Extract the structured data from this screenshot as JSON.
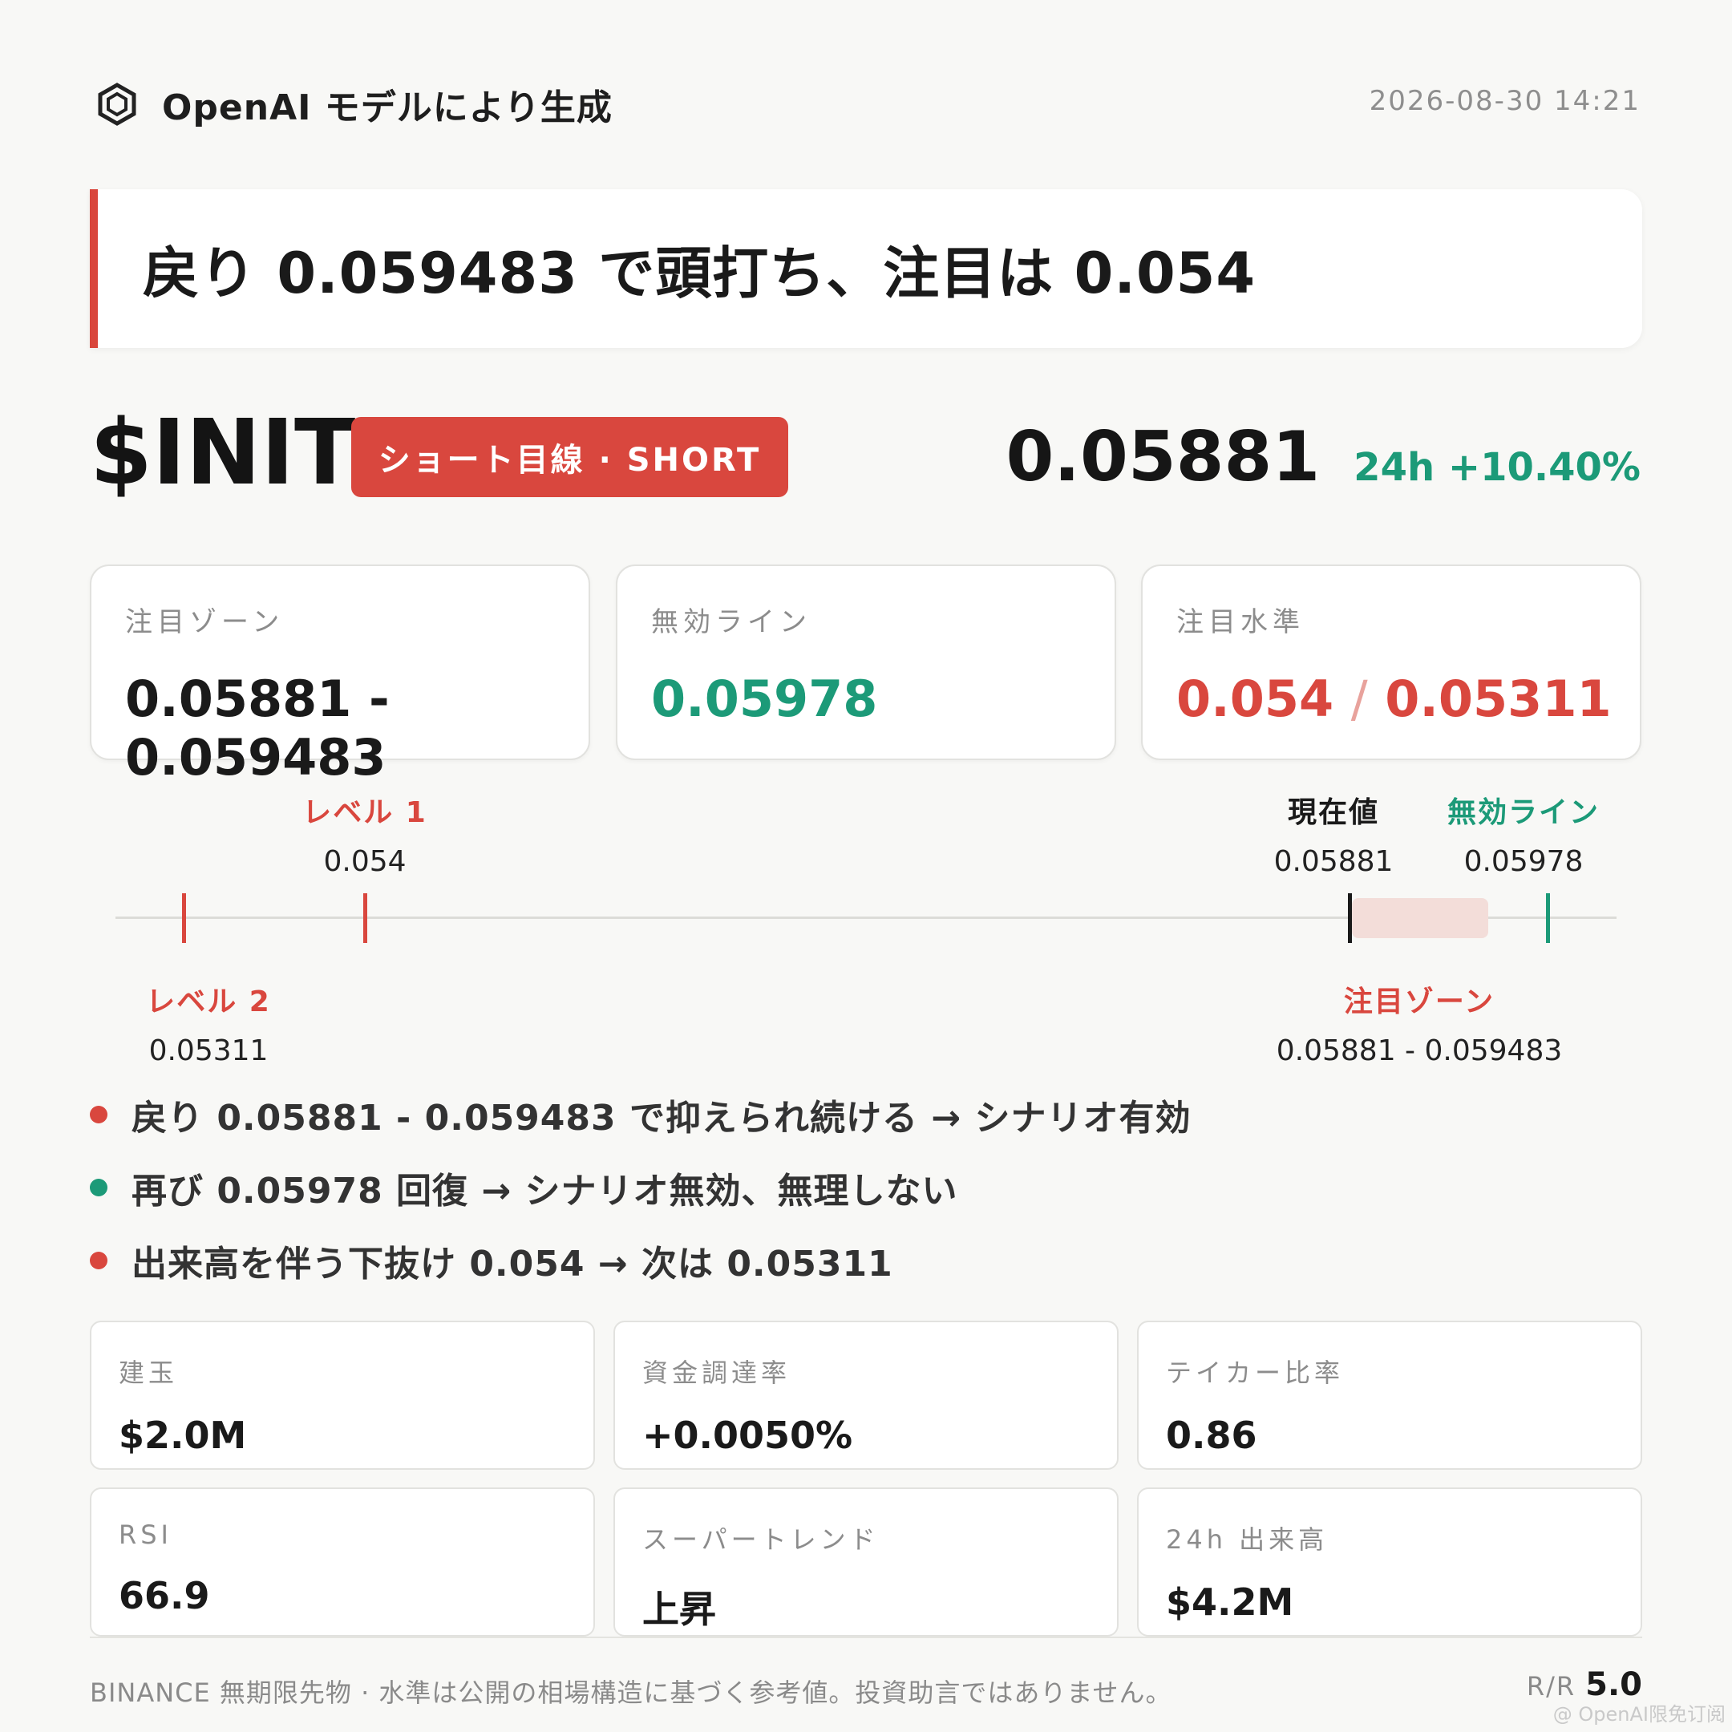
{
  "header": {
    "brand_icon": "hexagon-logo-icon",
    "brand_label": "OpenAI モデルにより生成",
    "timestamp": "2026-08-30 14:21"
  },
  "headline": {
    "text": "戻り 0.059483 で頭打ち、注目は 0.054",
    "accent_color": "#d9463c"
  },
  "ticker": {
    "symbol": "$INIT",
    "direction": "ショート目線 · SHORT",
    "price": "0.05881",
    "change": "24h +10.40%"
  },
  "levels": {
    "zone": {
      "label": "注目ゾーン",
      "value": "0.05881 - 0.059483"
    },
    "invalidation": {
      "label": "無効ライン",
      "value": "0.05978"
    },
    "targets": {
      "label": "注目水準",
      "value_1": "0.054",
      "separator": "/",
      "value_2": "0.05311"
    }
  },
  "diagram": {
    "level1": {
      "title": "レベル 1",
      "value": "0.054"
    },
    "level2": {
      "title": "レベル 2",
      "value": "0.05311"
    },
    "current": {
      "title": "現在値",
      "value": "0.05881"
    },
    "invalidation": {
      "title": "無効ライン",
      "value": "0.05978"
    },
    "zone": {
      "title": "注目ゾーン",
      "value": "0.05881 - 0.059483"
    }
  },
  "scenarios": [
    {
      "text": "戻り 0.05881 - 0.059483 で抑えられ続ける → シナリオ有効",
      "color": "#d9473e"
    },
    {
      "text": "再び 0.05978 回復 → シナリオ無効、無理しない",
      "color": "#1c9a78"
    },
    {
      "text": "出来高を伴う下抜け 0.054 → 次は 0.05311",
      "color": "#d9473e"
    }
  ],
  "metrics": [
    {
      "label": "建玉",
      "value": "$2.0M"
    },
    {
      "label": "資金調達率",
      "value": "+0.0050%"
    },
    {
      "label": "テイカー比率",
      "value": "0.86"
    },
    {
      "label": "RSI",
      "value": "66.9"
    },
    {
      "label": "スーパートレンド",
      "value": "上昇"
    },
    {
      "label": "24h 出来高",
      "value": "$4.2M"
    }
  ],
  "footer": {
    "disclaimer": "BINANCE 無期限先物 · 水準は公開の相場構造に基づく参考値。投資助言ではありません。",
    "rr_label": "R/R",
    "rr_value": "5.0",
    "watermark": "@ OpenAI限免订阅"
  },
  "colors": {
    "red": "#d9473e",
    "green": "#1c9a78",
    "zone_fill": "#f3ddd9",
    "background": "#f8f8f6"
  }
}
